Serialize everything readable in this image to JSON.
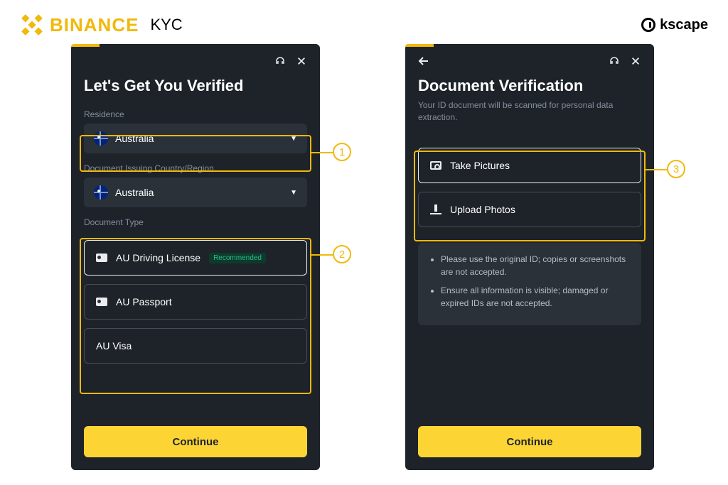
{
  "header": {
    "brand": "BINANCE",
    "page_label": "KYC",
    "watermark": "kscape"
  },
  "callouts": [
    "1",
    "2",
    "3"
  ],
  "panel_left": {
    "title": "Let's Get You Verified",
    "residence_label": "Residence",
    "residence_value": "Australia",
    "issuing_label": "Document Issuing Country/Region",
    "issuing_value": "Australia",
    "doctype_label": "Document Type",
    "options": [
      {
        "label": "AU Driving License",
        "tag": "Recommended",
        "selected": true
      },
      {
        "label": "AU Passport",
        "selected": false
      },
      {
        "label": "AU Visa",
        "selected": false
      }
    ],
    "continue": "Continue"
  },
  "panel_right": {
    "title": "Document Verification",
    "subtitle": "Your ID document will be scanned for personal data extraction.",
    "options": [
      {
        "label": "Take Pictures",
        "icon": "camera",
        "selected": true
      },
      {
        "label": "Upload Photos",
        "icon": "upload",
        "selected": false
      }
    ],
    "notices": [
      "Please use the original ID; copies or screenshots are not accepted.",
      "Ensure all information is visible; damaged or expired IDs are not accepted."
    ],
    "continue": "Continue"
  }
}
